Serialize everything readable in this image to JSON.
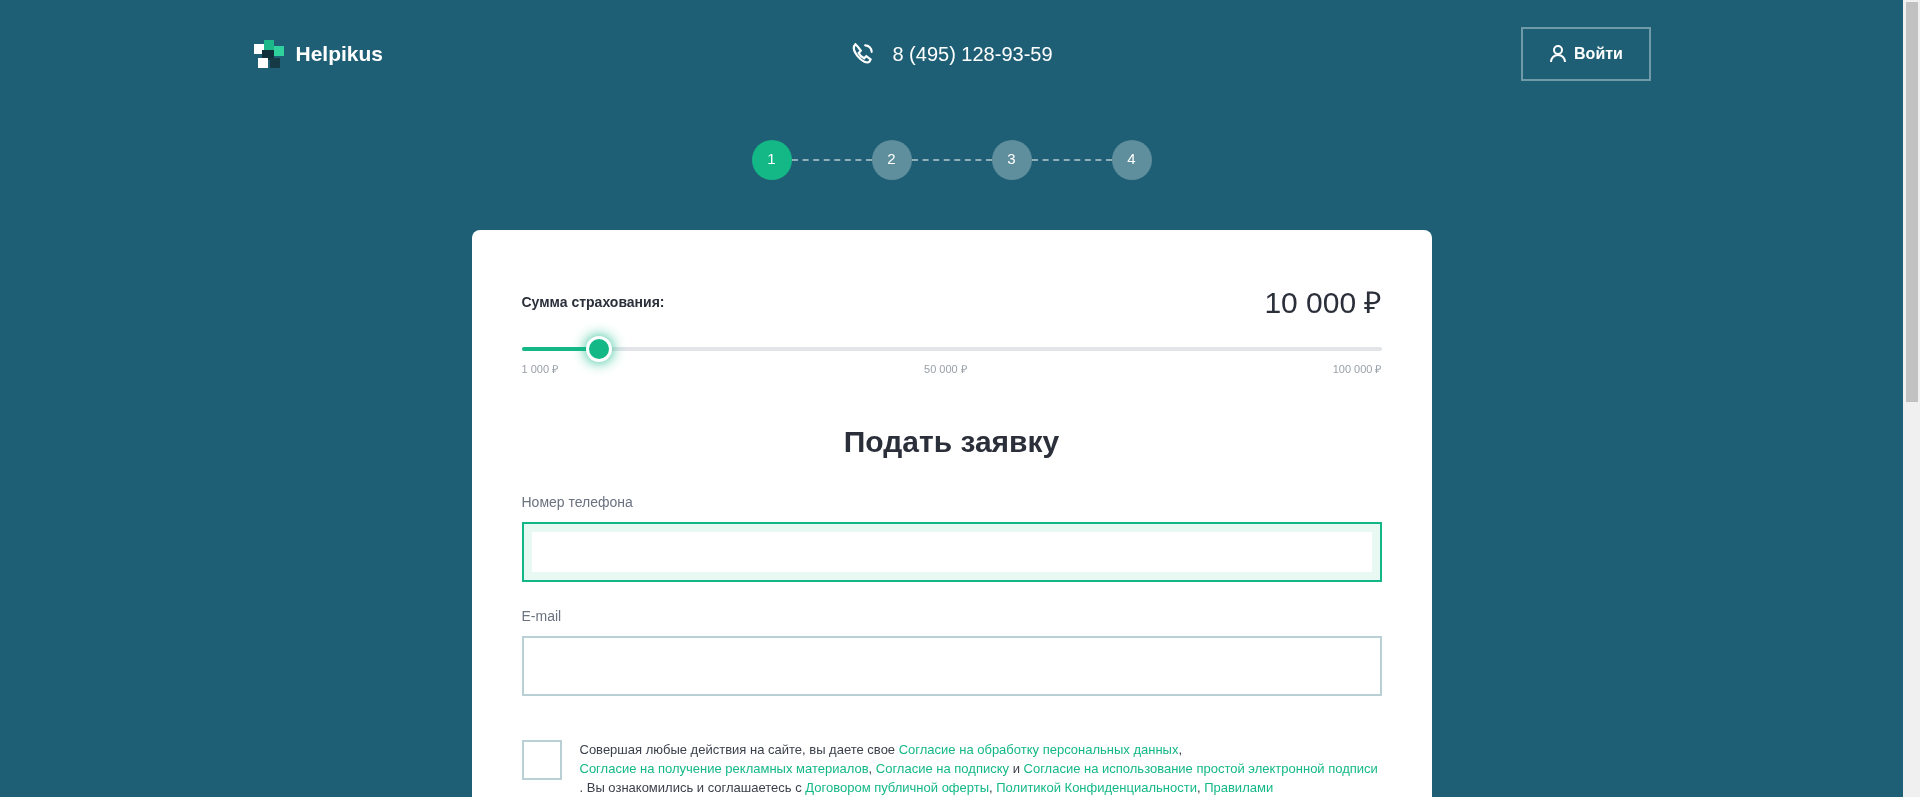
{
  "header": {
    "logo": "Helpikus",
    "phone": "8 (495) 128-93-59",
    "login_button": "Войти"
  },
  "steps": [
    {
      "label": "1",
      "selected": true
    },
    {
      "label": "2",
      "selected": false
    },
    {
      "label": "3",
      "selected": false
    },
    {
      "label": "4",
      "selected": false
    }
  ],
  "insurance": {
    "label": "Сумма страхования:",
    "amount": "10 000 ₽",
    "slider": {
      "level": 0.09,
      "ticks": [
        "1 000 ₽",
        "50 000 ₽",
        "100 000 ₽"
      ]
    }
  },
  "form": {
    "title": "Подать заявку",
    "fields": [
      {
        "label": "Номер телефона",
        "focused": true
      },
      {
        "label": "E-mail",
        "focused": false
      }
    ]
  },
  "consent": {
    "checked": false,
    "segments": [
      {
        "text": "Совершая любые действия на сайте, вы даете свое ",
        "link": false
      },
      {
        "text": "Согласие на обработку персональных данных",
        "link": true
      },
      {
        "text": ", ",
        "link": false
      },
      {
        "text": "Согласие на получение рекламных материалов",
        "link": true
      },
      {
        "text": ", ",
        "link": false
      },
      {
        "text": "Согласие на подписку",
        "link": true
      },
      {
        "text": " и ",
        "link": false
      },
      {
        "text": "Согласие на использование простой электронной подписи",
        "link": true
      },
      {
        "text": " . Вы ознакомились и соглашаетесь с ",
        "link": false
      },
      {
        "text": "Договором публичной оферты",
        "link": true
      },
      {
        "text": ", ",
        "link": false
      },
      {
        "text": "Политикой Конфиденциальности",
        "link": true
      },
      {
        "text": ", ",
        "link": false
      },
      {
        "text": "Правилами",
        "link": true
      }
    ]
  }
}
